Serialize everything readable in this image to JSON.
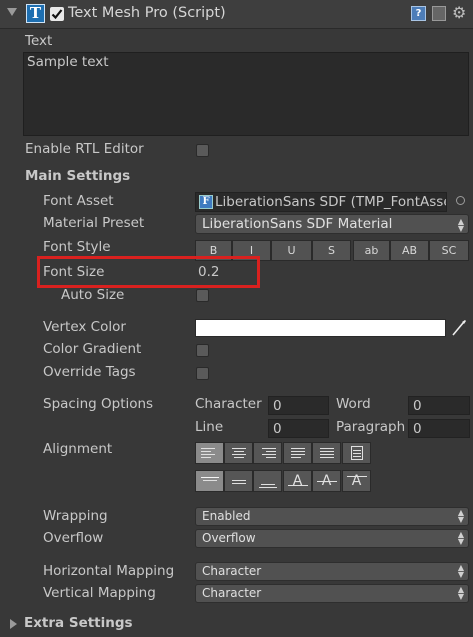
{
  "header": {
    "title": "Text Mesh Pro (Script)",
    "enabled": true
  },
  "text_section": {
    "label": "Text",
    "value": "Sample text"
  },
  "rtl": {
    "label": "Enable RTL Editor",
    "checked": false
  },
  "main_settings": {
    "heading": "Main Settings",
    "font_asset": {
      "label": "Font Asset",
      "value": "LiberationSans SDF (TMP_FontAsset)"
    },
    "material_preset": {
      "label": "Material Preset",
      "value": "LiberationSans SDF Material"
    },
    "font_style": {
      "label": "Font Style",
      "buttons": [
        "B",
        "I",
        "U",
        "S",
        "ab",
        "AB",
        "SC"
      ]
    },
    "font_size": {
      "label": "Font Size",
      "value": "0.2",
      "highlighted": true,
      "highlight_color": "#d9211f"
    },
    "auto_size": {
      "label": "Auto Size",
      "checked": false
    },
    "vertex_color": {
      "label": "Vertex Color",
      "color": "#ffffff"
    },
    "color_gradient": {
      "label": "Color Gradient",
      "checked": false
    },
    "override_tags": {
      "label": "Override Tags",
      "checked": false
    },
    "spacing": {
      "label": "Spacing Options",
      "character": {
        "label": "Character",
        "value": "0"
      },
      "word": {
        "label": "Word",
        "value": "0"
      },
      "line": {
        "label": "Line",
        "value": "0"
      },
      "paragraph": {
        "label": "Paragraph",
        "value": "0"
      }
    },
    "alignment": {
      "label": "Alignment",
      "horizontal": [
        "align-left-icon",
        "align-center-icon",
        "align-right-icon",
        "align-justified-icon",
        "align-flush-icon",
        "align-geometry-center-icon"
      ],
      "horizontal_selected": 0,
      "vertical": [
        "align-top-icon",
        "align-middle-icon",
        "align-bottom-icon",
        "align-baseline-icon",
        "align-midline-icon",
        "align-capline-icon"
      ],
      "vertical_selected": 0
    },
    "wrapping": {
      "label": "Wrapping",
      "value": "Enabled"
    },
    "overflow": {
      "label": "Overflow",
      "value": "Overflow"
    },
    "horizontal_mapping": {
      "label": "Horizontal Mapping",
      "value": "Character"
    },
    "vertical_mapping": {
      "label": "Vertical Mapping",
      "value": "Character"
    }
  },
  "extra_settings": {
    "heading": "Extra Settings"
  }
}
